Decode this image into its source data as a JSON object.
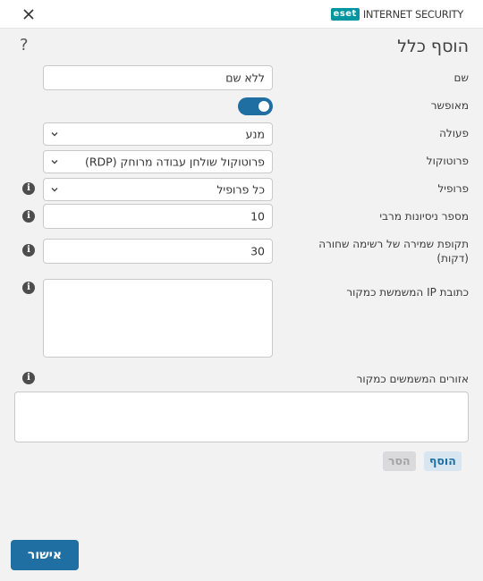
{
  "brand": {
    "logo": "eset",
    "product": "INTERNET SECURITY"
  },
  "page": {
    "title": "הוסף כלל",
    "help_glyph": "?"
  },
  "form": {
    "name": {
      "label": "שם",
      "value": "ללא שם"
    },
    "enabled": {
      "label": "מאופשר",
      "value": true
    },
    "action": {
      "label": "פעולה",
      "value": "מנע"
    },
    "protocol": {
      "label": "פרוטוקול",
      "value": "פרוטוקול שולחן עבודה מרוחק (RDP)"
    },
    "profile": {
      "label": "פרופיל",
      "value": "כל פרופיל"
    },
    "max_attempts": {
      "label": "מספר ניסיונות מרבי",
      "value": "10"
    },
    "blacklist_retention": {
      "label_line1": "תקופת שמירה של רשימה שחורה",
      "label_line2": "(דקות)",
      "value": "30"
    },
    "source_ip": {
      "label": "כתובת IP המשמשת כמקור",
      "value": ""
    },
    "source_zones": {
      "label": "אזורים המשמשים כמקור"
    }
  },
  "buttons": {
    "add": "הוסף",
    "remove": "הסר",
    "ok": "אישור"
  },
  "colors": {
    "accent": "#1f6fa3",
    "eset_teal": "#0096a1"
  },
  "icons": {
    "close": "close-icon",
    "info": "info-icon",
    "chevron": "chevron-down-icon",
    "help": "help-icon"
  }
}
